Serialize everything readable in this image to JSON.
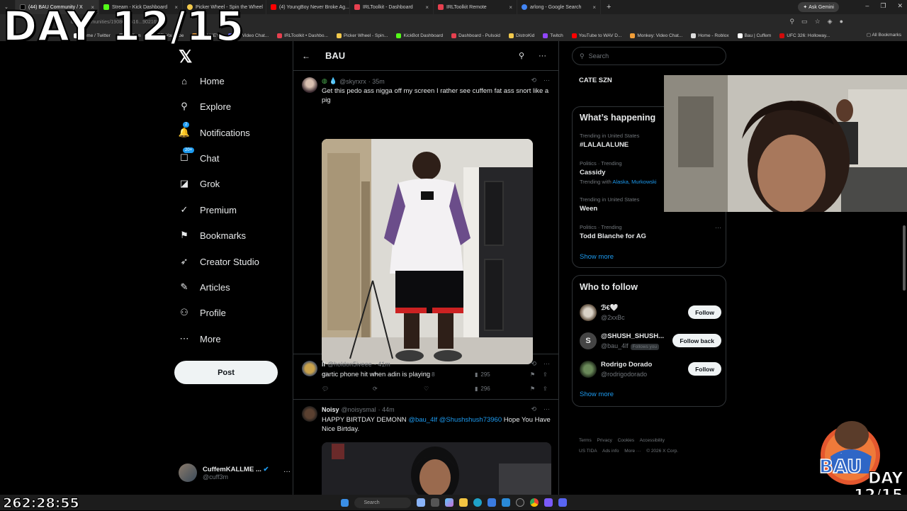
{
  "browser": {
    "tabs": [
      {
        "label": "(44) BAU Community / X",
        "color": "#000000"
      },
      {
        "label": "Stream - Kick Dashboard",
        "color": "#53fc18"
      },
      {
        "label": "Picker Wheel - Spin the Wheel",
        "color": "#f2c94c"
      },
      {
        "label": "(4) YoungBoy Never Broke Ag...",
        "color": "#ff0000"
      },
      {
        "label": "IRLToolkit - Dashboard",
        "color": "#e6404f"
      },
      {
        "label": "IRLToolkit Remote",
        "color": "#e6404f"
      },
      {
        "label": "arlong - Google Search",
        "color": "#4285f4"
      }
    ],
    "new_tab": "+",
    "ask_gemini": "Ask Gemini",
    "url_fragment": "om/i/communities/1908678516...902169",
    "bookmarks": [
      {
        "label": "Home / Twitter",
        "color": "#ffffff"
      },
      {
        "label": "Cuffem",
        "color": "#888888"
      },
      {
        "label": "(57) YouTube",
        "color": "#ff0000"
      },
      {
        "label": "MONKEY",
        "color": "#f29e38"
      },
      {
        "label": "TV Video Chat...",
        "color": "#6b6bff"
      },
      {
        "label": "IRLToolkit • Dashbo...",
        "color": "#e6404f"
      },
      {
        "label": "Picker Wheel - Spin...",
        "color": "#f2c94c"
      },
      {
        "label": "KickBot Dashboard",
        "color": "#53fc18"
      },
      {
        "label": "Dashboard - Pulsoid",
        "color": "#e6404f"
      },
      {
        "label": "DistroKid",
        "color": "#f2c94c"
      },
      {
        "label": "Twitch",
        "color": "#9146ff"
      },
      {
        "label": "YouTube to WAV D...",
        "color": "#ff0000"
      },
      {
        "label": "Monkey: Video Chat...",
        "color": "#f29e38"
      },
      {
        "label": "Home - Roblox",
        "color": "#dddddd"
      },
      {
        "label": "Bau | Cuffem",
        "color": "#ffffff"
      },
      {
        "label": "UFC 326: Holloway...",
        "color": "#d20a0a"
      }
    ],
    "all_bookmarks": "All Bookmarks"
  },
  "overlay": {
    "day_label": "DAY 12/15",
    "clock": "262:28:55",
    "corner_day": "DAY",
    "corner_frac": "12/15",
    "logo_text": "BAU"
  },
  "sidebar": {
    "logo": "𝕏",
    "items": [
      {
        "label": "Home",
        "icon": "home-icon",
        "glyph": "⌂"
      },
      {
        "label": "Explore",
        "icon": "search-icon",
        "glyph": "⚲"
      },
      {
        "label": "Notifications",
        "icon": "bell-icon",
        "glyph": "🔔",
        "badge": "2"
      },
      {
        "label": "Chat",
        "icon": "chat-icon",
        "glyph": "☐",
        "badge": "20+"
      },
      {
        "label": "Grok",
        "icon": "grok-icon",
        "glyph": "◪"
      },
      {
        "label": "Premium",
        "icon": "premium-icon",
        "glyph": "✓"
      },
      {
        "label": "Bookmarks",
        "icon": "bookmark-icon",
        "glyph": "⚑"
      },
      {
        "label": "Creator Studio",
        "icon": "rocket-icon",
        "glyph": "➶"
      },
      {
        "label": "Articles",
        "icon": "articles-icon",
        "glyph": "✎"
      },
      {
        "label": "Profile",
        "icon": "profile-icon",
        "glyph": "⚇"
      },
      {
        "label": "More",
        "icon": "more-icon",
        "glyph": "⋯"
      }
    ],
    "post_label": "Post",
    "account": {
      "name": "CuffemKALLME ...",
      "handle": "@cuff3m"
    }
  },
  "timeline": {
    "title": "BAU",
    "tweets": [
      {
        "name": "",
        "handle": "@skyrxrx",
        "time": "· 35m",
        "text": "Get this pedo ass nigga off my screen I rather see cuffem fat ass snort like a pig",
        "likes": "8",
        "views": "295"
      },
      {
        "name": "ll",
        "handle": "@holdon5iveee",
        "time": "· 41m",
        "text": "gartic phone hit when adin is playing",
        "likes": "",
        "views": "296"
      },
      {
        "name": "Noisy",
        "handle": "@noisysmal",
        "time": "· 44m",
        "text_before": "HAPPY BIRTDAY DEMONN ",
        "mention1": "@bau_4lf",
        "mention2": "@Shushshush73960",
        "text_after": " Hope You Have Nice Birtday."
      }
    ]
  },
  "right": {
    "search_placeholder": "Search",
    "pinned": "CATE SZN",
    "happening_title": "What’s happening",
    "trends": [
      {
        "context": "Trending in United States",
        "name": "#LALALALUNE",
        "with": ""
      },
      {
        "context": "Politics · Trending",
        "name": "Cassidy",
        "with": "Trending with",
        "with_links": "Alaska, Murkowski"
      },
      {
        "context": "Trending in United States",
        "name": "Ween",
        "with": ""
      },
      {
        "context": "Politics · Trending",
        "name": "Todd Blanche for AG",
        "with": ""
      }
    ],
    "show_more": "Show more",
    "who_title": "Who to follow",
    "follow": [
      {
        "name": "ℬ€🤍",
        "handle": "@2xxBc",
        "button": "Follow",
        "follows_you": ""
      },
      {
        "name": "@SHUSH_SHUSH...",
        "handle": "@bau_4lf",
        "button": "Follow back",
        "follows_you": "Follows you"
      },
      {
        "name": "Rodrigo Dorado",
        "handle": "@rodrigodorado",
        "button": "Follow",
        "follows_you": ""
      }
    ],
    "footer": [
      "Terms",
      "Privacy",
      "Cookies",
      "Accessibility",
      "US TIDA",
      "Ads info",
      "More ···",
      "© 2026 X Corp."
    ]
  },
  "taskbar": {
    "search": "Search"
  }
}
